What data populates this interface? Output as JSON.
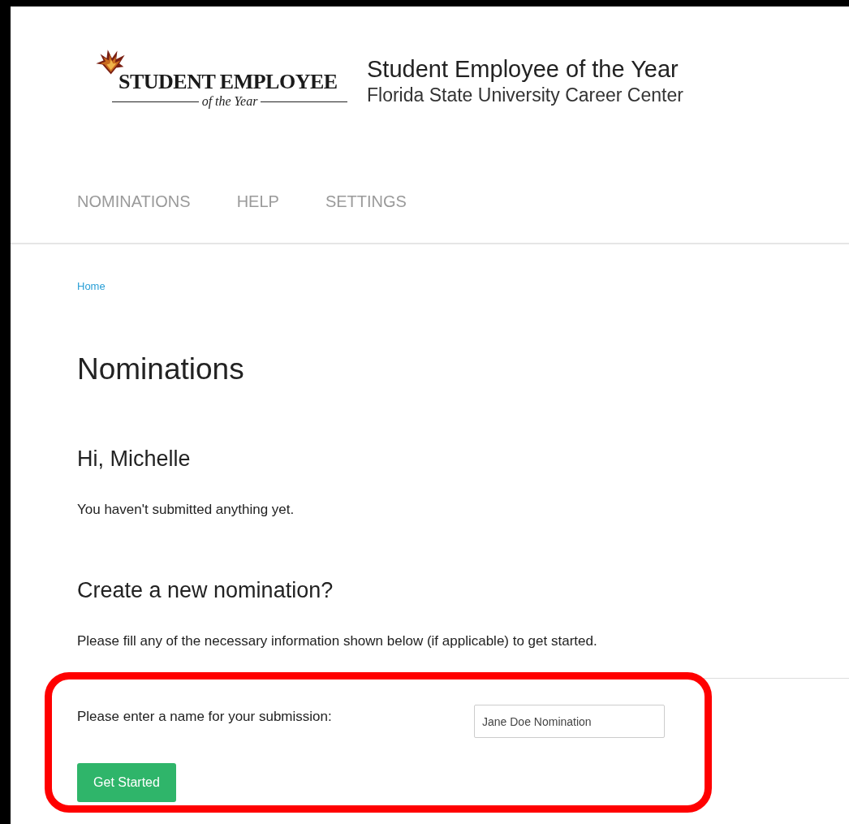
{
  "logo": {
    "title": "STUDENT EMPLOYEE",
    "subtitle": "of the Year"
  },
  "header": {
    "title": "Student Employee of the Year",
    "subtitle": "Florida State University Career Center"
  },
  "nav": [
    {
      "label": "NOMINATIONS",
      "selected": false
    },
    {
      "label": "HELP",
      "selected": false
    },
    {
      "label": "SETTINGS",
      "selected": false
    }
  ],
  "breadcrumb": [
    "Home"
  ],
  "page_title": "Nominations",
  "greeting": "Hi, Michelle",
  "message": "You haven't submitted anything yet.",
  "section_title": "Create a new nomination?",
  "instructions": "Please fill any of the necessary information shown below (if applicable) to get started.",
  "form": {
    "label": "Please enter a name for your submission:",
    "value": "Jane Doe Nomination",
    "button": "Get Started"
  }
}
